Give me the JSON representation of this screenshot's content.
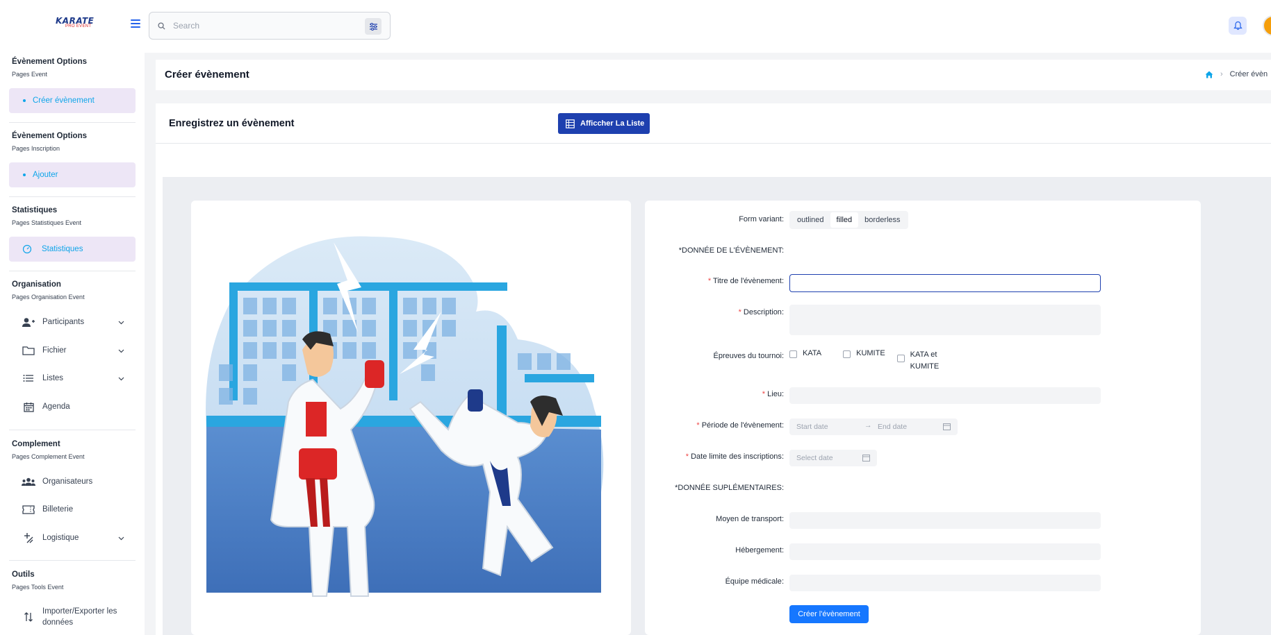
{
  "header": {
    "logo_main": "KARATE",
    "logo_sub": "PRO EVENT",
    "search_placeholder": "Search"
  },
  "sidebar": {
    "sections": [
      {
        "title": "Évènement Options",
        "subtitle": "Pages Event",
        "active_item": "Créer évènement"
      },
      {
        "title": "Évènement Options",
        "subtitle": "Pages Inscription",
        "active_item": "Ajouter"
      },
      {
        "title": "Statistiques",
        "subtitle": "Pages Statistiques Event",
        "active_item": "Statistiques"
      },
      {
        "title": "Organisation",
        "subtitle": "Pages Organisation Event",
        "items": [
          "Participants",
          "Fichier",
          "Listes",
          "Agenda"
        ]
      },
      {
        "title": "Complement",
        "subtitle": "Pages Complement Event",
        "items": [
          "Organisateurs",
          "Billeterie",
          "Logistique"
        ]
      },
      {
        "title": "Outils",
        "subtitle": "Pages Tools Event",
        "items": [
          "Importer/Exporter les",
          "données"
        ]
      }
    ]
  },
  "page": {
    "title": "Créer évènement",
    "breadcrumb_current": "Créer évèn"
  },
  "card": {
    "title": "Enregistrez un évènement",
    "list_button": "Afficcher La Liste"
  },
  "form": {
    "variant_label": "Form variant",
    "variants": [
      "outlined",
      "filled",
      "borderless"
    ],
    "selected_variant": "filled",
    "section_event": "*DONNÉE DE L'ÉVÈNEMENT",
    "title_label": "Titre de l'évènement",
    "description_label": "Description",
    "events_label": "Épreuves du tournoi",
    "events_options": [
      "KATA",
      "KUMITE",
      "KATA et",
      "KUMITE"
    ],
    "location_label": "Lieu",
    "period_label": "Période de l'évènement",
    "start_placeholder": "Start date",
    "end_placeholder": "End date",
    "deadline_label": "Date limite des inscriptions",
    "deadline_placeholder": "Select date",
    "section_extra": "*DONNÉE SUPLÉMENTAIRES",
    "transport_label": "Moyen de transport",
    "lodging_label": "Hébergement",
    "medical_label": "Équipe médicale",
    "submit": "Créer l'évènement",
    "colon": ":",
    "required_mark": "*"
  }
}
